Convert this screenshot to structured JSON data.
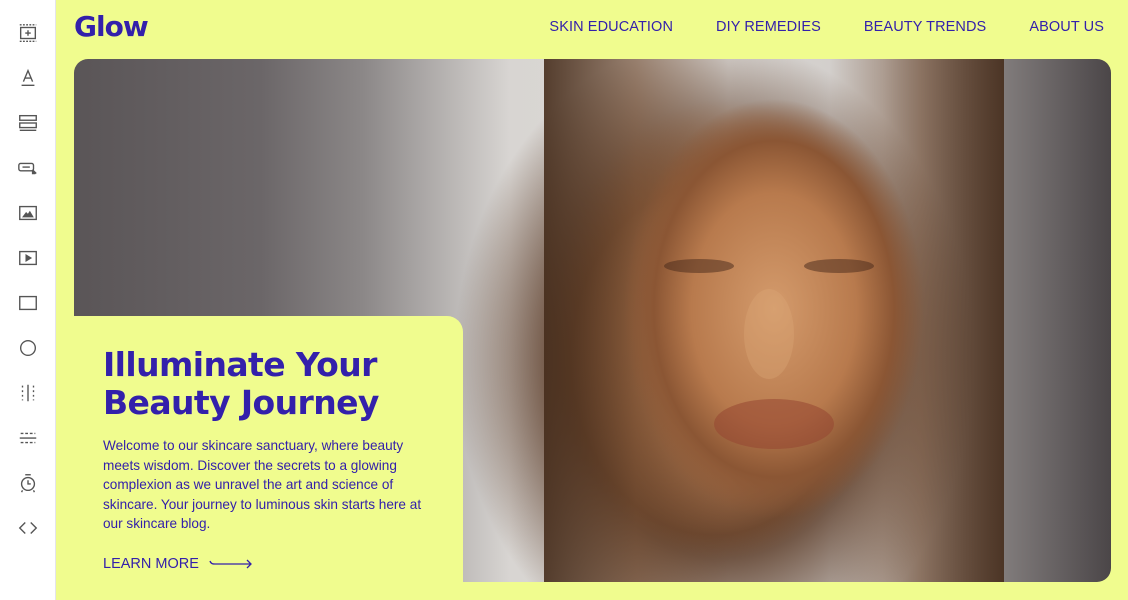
{
  "toolbar": {
    "tools": [
      {
        "name": "add-section-icon"
      },
      {
        "name": "text-icon"
      },
      {
        "name": "layout-rows-icon"
      },
      {
        "name": "button-icon"
      },
      {
        "name": "image-icon"
      },
      {
        "name": "video-icon"
      },
      {
        "name": "rectangle-icon"
      },
      {
        "name": "circle-icon"
      },
      {
        "name": "vertical-divider-icon"
      },
      {
        "name": "horizontal-divider-icon"
      },
      {
        "name": "timer-icon"
      },
      {
        "name": "code-icon"
      }
    ]
  },
  "header": {
    "logo": "Glow",
    "nav": [
      "SKIN EDUCATION",
      "DIY REMEDIES",
      "BEAUTY TRENDS",
      "ABOUT US"
    ]
  },
  "hero": {
    "image_alt": "Close-up portrait of a woman with closed eyes in sunlight",
    "headline_line1": "Illuminate Your",
    "headline_line2": "Beauty Journey",
    "body": "Welcome to our skincare sanctuary, where beauty meets wisdom. Discover the secrets to a glowing complexion as we unravel the art and science of skincare. Your journey to luminous skin starts here at our skincare blog.",
    "cta_label": "LEARN MORE",
    "cta_icon": "long-arrow-right-icon"
  },
  "colors": {
    "background": "#f0fc8e",
    "accent": "#3320ab",
    "toolbar_icon": "#555555"
  }
}
